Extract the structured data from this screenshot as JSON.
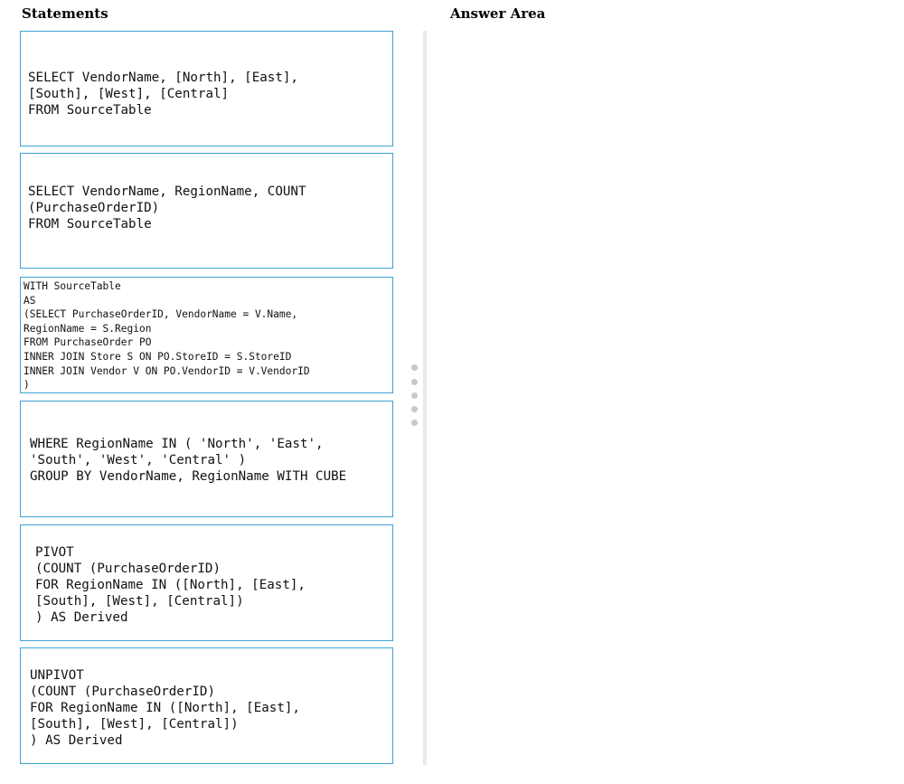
{
  "headings": {
    "statements": "Statements",
    "answer_area": "Answer Area"
  },
  "statements": [
    {
      "code": "SELECT VendorName, [North], [East],\n[South], [West], [Central]\nFROM SourceTable"
    },
    {
      "code": "SELECT VendorName, RegionName, COUNT\n(PurchaseOrderID)\nFROM SourceTable"
    },
    {
      "code": "WITH SourceTable\nAS\n(SELECT PurchaseOrderID, VendorName = V.Name,\nRegionName = S.Region\nFROM PurchaseOrder PO\nINNER JOIN Store S ON PO.StoreID = S.StoreID\nINNER JOIN Vendor V ON PO.VendorID = V.VendorID\n)"
    },
    {
      "code": "WHERE RegionName IN ( 'North', 'East',\n'South', 'West', 'Central' )\nGROUP BY VendorName, RegionName WITH CUBE"
    },
    {
      "code": "PIVOT\n(COUNT (PurchaseOrderID)\nFOR RegionName IN ([North], [East],\n[South], [West], [Central])\n) AS Derived"
    },
    {
      "code": "UNPIVOT\n(COUNT (PurchaseOrderID)\nFOR RegionName IN ([North], [East],\n[South], [West], [Central])\n) AS Derived"
    }
  ],
  "answer_area": {
    "items": []
  },
  "colors": {
    "card_border": "#3ea3d4",
    "divider": "#e9e9e9",
    "handle_dot": "#c8c8c8"
  },
  "icons": {
    "splitter": "grip-dots-icon"
  }
}
